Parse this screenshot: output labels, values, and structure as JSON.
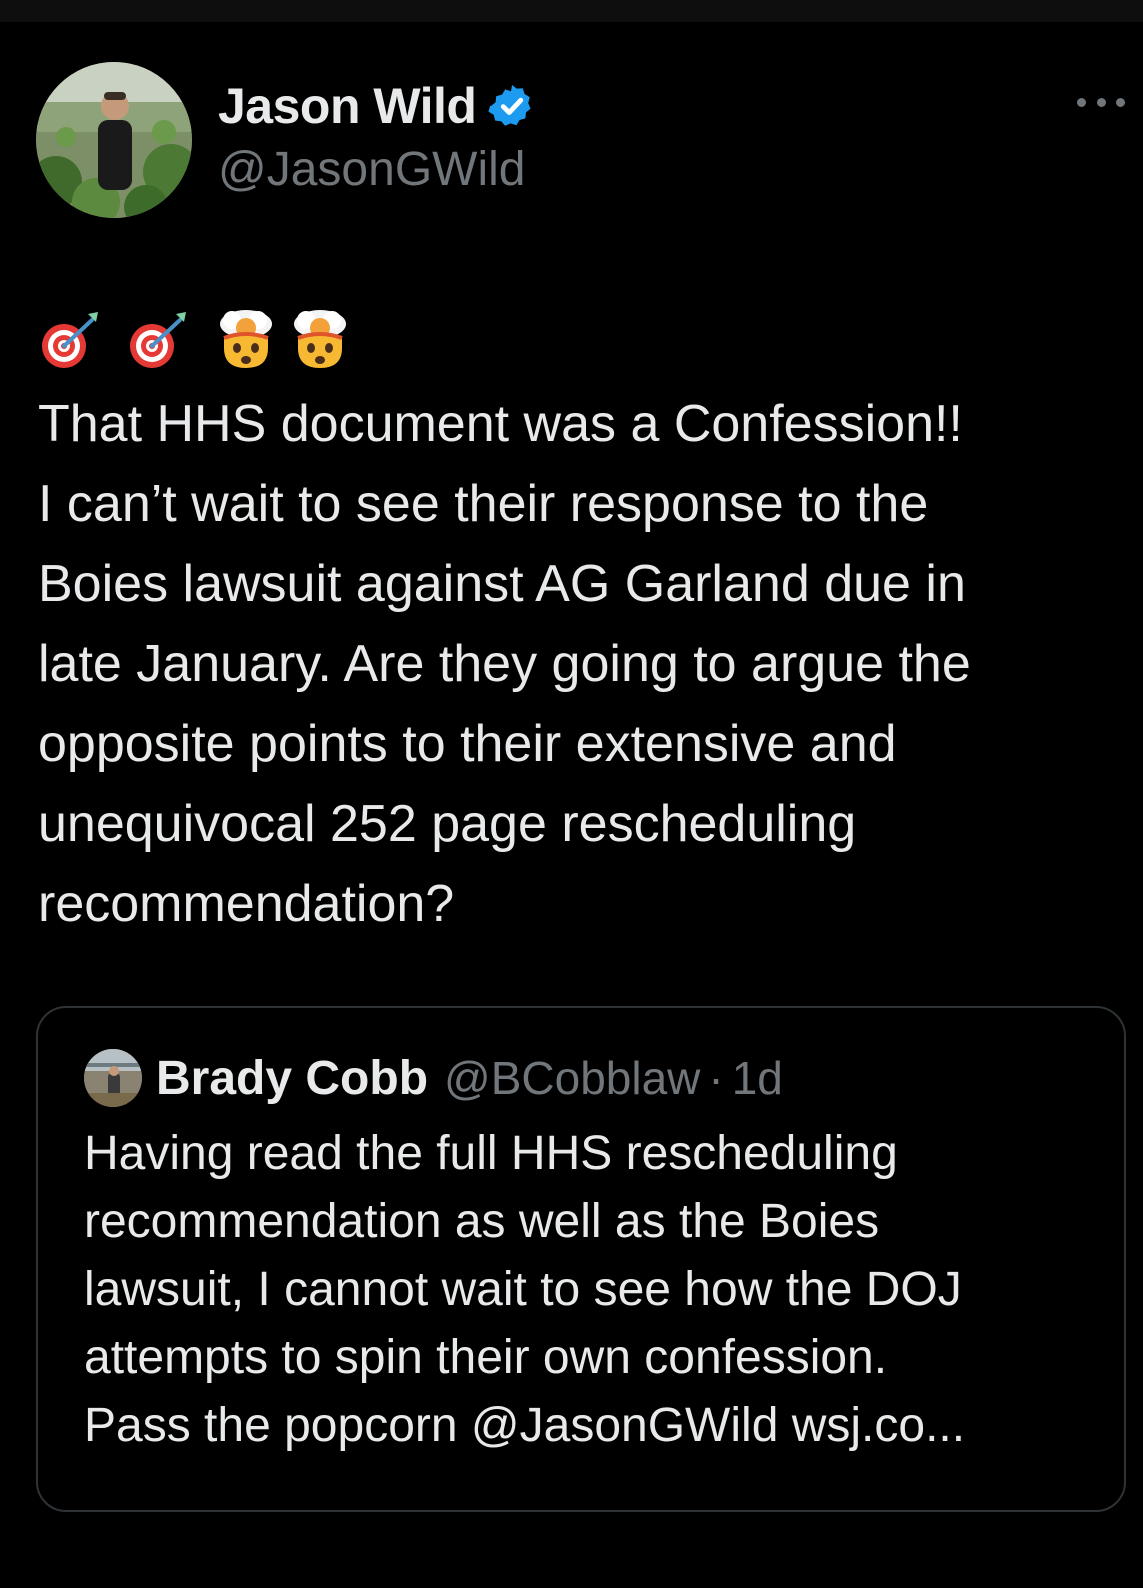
{
  "author": {
    "name": "Jason Wild",
    "handle": "@JasonGWild"
  },
  "tweet": {
    "emojis": [
      "direct-hit",
      "direct-hit",
      "exploding-head",
      "exploding-head"
    ],
    "lines": [
      "That HHS document was a Confession!!",
      "I can’t wait to see their response to the",
      "Boies lawsuit against AG Garland due in",
      "late January. Are they going to argue the",
      "opposite points to their extensive and",
      "unequivocal 252 page rescheduling",
      "recommendation?"
    ]
  },
  "quote": {
    "name": "Brady Cobb",
    "handle": "@BCobblaw",
    "separator": "·",
    "time": "1d",
    "lines": [
      "Having read the full HHS rescheduling",
      "recommendation as well as the Boies",
      "lawsuit, I cannot wait to see how the DOJ",
      "attempts to spin their own confession.",
      "Pass the popcorn @JasonGWild wsj.co..."
    ]
  },
  "colors": {
    "background": "#000000",
    "text": "#e7e9ea",
    "secondary": "#71767b",
    "border": "#2f3336",
    "verified": "#1d9bf0"
  }
}
